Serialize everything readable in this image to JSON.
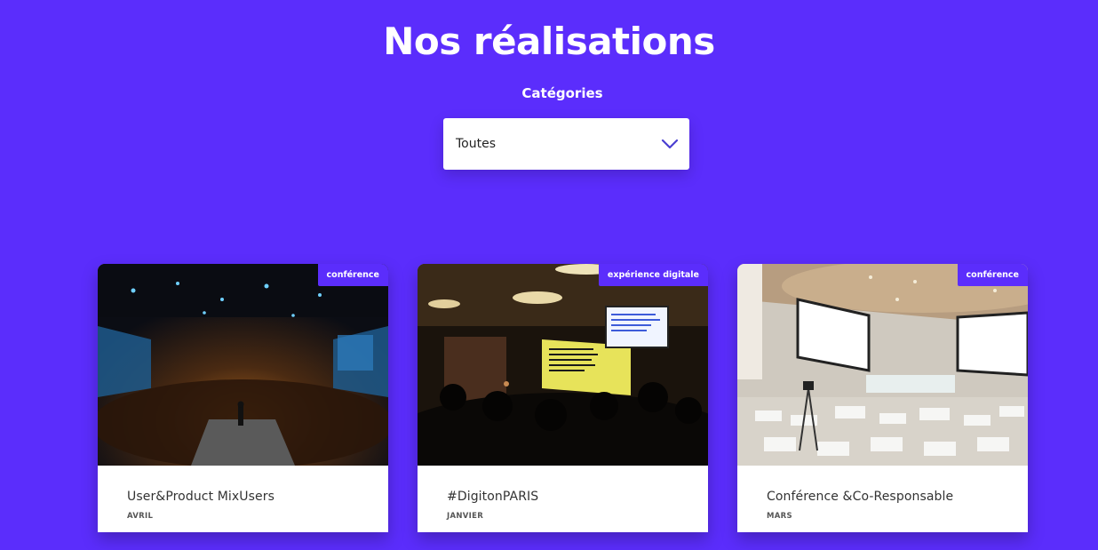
{
  "heading": "Nos réalisations",
  "filter": {
    "label": "Catégories",
    "selected": "Toutes"
  },
  "colors": {
    "background": "#5b2dfc",
    "accent": "#4a3fd1",
    "card": "#ffffff"
  },
  "cards": [
    {
      "badge": "conférence",
      "title": "User&Product MixUsers",
      "date": "AVRIL",
      "image": "event-hall-audience-photo"
    },
    {
      "badge": "expérience digitale",
      "title": "#DigitonPARIS",
      "date": "JANVIER",
      "image": "dark-venue-speaker-photo"
    },
    {
      "badge": "conférence",
      "title": "Conférence &Co-Responsable",
      "date": "MARS",
      "image": "conference-room-screens-photo"
    }
  ]
}
